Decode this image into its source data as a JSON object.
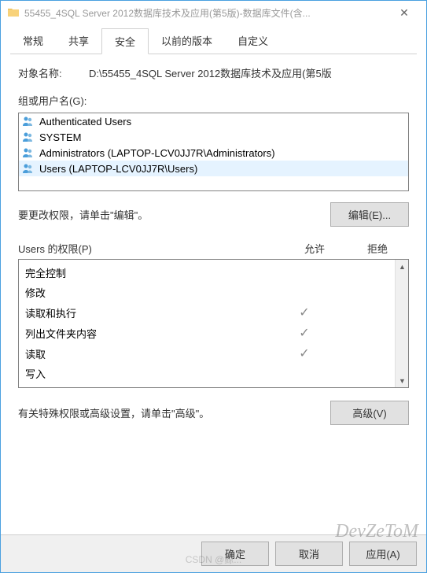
{
  "titlebar": {
    "title": "55455_4SQL Server 2012数据库技术及应用(第5版)-数据库文件(含...",
    "close": "✕"
  },
  "tabs": [
    {
      "label": "常规"
    },
    {
      "label": "共享"
    },
    {
      "label": "安全"
    },
    {
      "label": "以前的版本"
    },
    {
      "label": "自定义"
    }
  ],
  "object": {
    "label": "对象名称:",
    "value": "D:\\55455_4SQL Server 2012数据库技术及应用(第5版"
  },
  "groups": {
    "label": "组或用户名(G):",
    "items": [
      {
        "name": "Authenticated Users",
        "selected": false
      },
      {
        "name": "SYSTEM",
        "selected": false
      },
      {
        "name": "Administrators (LAPTOP-LCV0JJ7R\\Administrators)",
        "selected": false
      },
      {
        "name": "Users (LAPTOP-LCV0JJ7R\\Users)",
        "selected": true
      }
    ]
  },
  "edit": {
    "text": "要更改权限，请单击\"编辑\"。",
    "button": "编辑(E)..."
  },
  "perms": {
    "header": "Users 的权限(P)",
    "allow": "允许",
    "deny": "拒绝",
    "items": [
      {
        "name": "完全控制",
        "allow": false,
        "deny": false
      },
      {
        "name": "修改",
        "allow": false,
        "deny": false
      },
      {
        "name": "读取和执行",
        "allow": true,
        "deny": false
      },
      {
        "name": "列出文件夹内容",
        "allow": true,
        "deny": false
      },
      {
        "name": "读取",
        "allow": true,
        "deny": false
      },
      {
        "name": "写入",
        "allow": false,
        "deny": false
      }
    ]
  },
  "advanced": {
    "text": "有关特殊权限或高级设置，请单击\"高级\"。",
    "button": "高级(V)"
  },
  "buttons": {
    "ok": "确定",
    "cancel": "取消",
    "apply": "应用(A)"
  },
  "watermark": "DevZeToM",
  "watermark2": "CSDN @鲸..."
}
